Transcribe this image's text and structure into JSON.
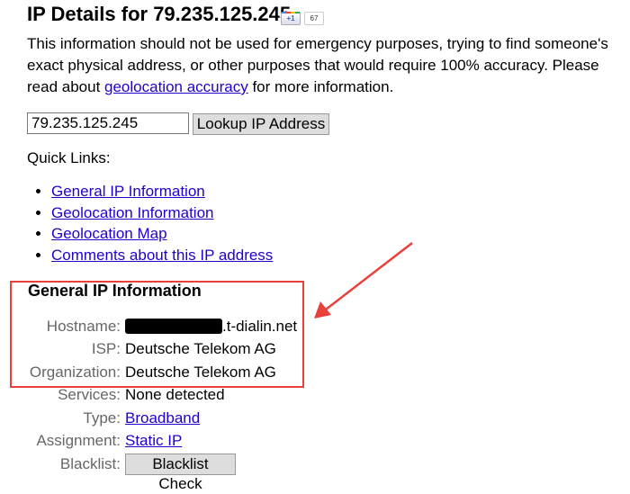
{
  "title": "IP Details for 79.235.125.245",
  "social": {
    "plus_label": "+1",
    "count": "67"
  },
  "intro": {
    "text1": "This information should not be used for emergency purposes, trying to find someone's exact physical address, or other purposes that would require 100% accuracy. Please read about ",
    "link": "geolocation accuracy",
    "text2": " for more information."
  },
  "lookup": {
    "value": "79.235.125.245",
    "button": "Lookup IP Address"
  },
  "quick_links": {
    "heading": "Quick Links:",
    "items": [
      "General IP Information",
      "Geolocation Information",
      "Geolocation Map",
      "Comments about this IP address"
    ]
  },
  "general": {
    "heading": "General IP Information",
    "rows": [
      {
        "label": "Hostname:",
        "value": ".t-dialin.net"
      },
      {
        "label": "ISP:",
        "value": "Deutsche Telekom AG"
      },
      {
        "label": "Organization:",
        "value": "Deutsche Telekom AG"
      },
      {
        "label": "Services:",
        "value": "None detected"
      },
      {
        "label": "Type:",
        "value": "Broadband"
      },
      {
        "label": "Assignment:",
        "value": "Static IP"
      },
      {
        "label": "Blacklist:",
        "value": "Blacklist Check"
      }
    ]
  },
  "annotation": {
    "color": "#e8403a"
  }
}
